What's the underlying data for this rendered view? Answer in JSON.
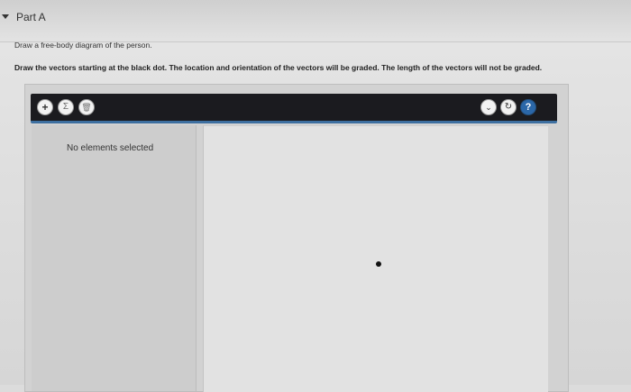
{
  "part": {
    "title": "Part A"
  },
  "instructions": {
    "line1": "Draw a free-body diagram of the person.",
    "line2": "Draw the vectors starting at the black dot. The location and orientation of the vectors will be graded. The length of the vectors will not be graded."
  },
  "toolbar": {
    "add_label": "+",
    "sum_label": "Σ",
    "trash_label": "🗑",
    "more_label": "⌄",
    "reset_label": "↻",
    "help_label": "?"
  },
  "panel": {
    "status": "No elements selected"
  },
  "icons": {
    "collapse": "caret-down-icon",
    "add": "plus-icon",
    "sum": "sigma-icon",
    "trash": "trash-icon",
    "more": "chevron-down-icon",
    "reset": "reset-icon",
    "help": "help-icon"
  },
  "colors": {
    "toolbar_bg": "#1b1b1f",
    "toolbar_accent": "#3d6fa0",
    "help_button": "#2b67a8",
    "dot": "#111111"
  }
}
